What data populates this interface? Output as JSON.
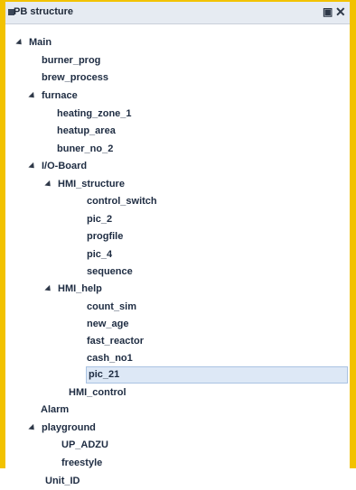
{
  "panel": {
    "title": "PB structure"
  },
  "tree": [
    {
      "label": "Main",
      "expanded": true
    },
    {
      "label": "burner_prog"
    },
    {
      "label": "brew_process"
    },
    {
      "label": "furnace",
      "expanded": true
    },
    {
      "label": "heating_zone_1"
    },
    {
      "label": "heatup_area"
    },
    {
      "label": "buner_no_2"
    },
    {
      "label": "I/O-Board",
      "expanded": true
    },
    {
      "label": "HMI_structure",
      "expanded": true
    },
    {
      "label": "control_switch"
    },
    {
      "label": "pic_2"
    },
    {
      "label": "progfile"
    },
    {
      "label": "pic_4"
    },
    {
      "label": "sequence"
    },
    {
      "label": "HMI_help",
      "expanded": true
    },
    {
      "label": "count_sim"
    },
    {
      "label": "new_age"
    },
    {
      "label": "fast_reactor"
    },
    {
      "label": "cash_no1"
    },
    {
      "label": "pic_21",
      "selected": true
    },
    {
      "label": "HMI_control"
    },
    {
      "label": "Alarm"
    },
    {
      "label": "playground",
      "expanded": true
    },
    {
      "label": "UP_ADZU"
    },
    {
      "label": "freestyle"
    },
    {
      "label": "Unit_ID"
    }
  ]
}
